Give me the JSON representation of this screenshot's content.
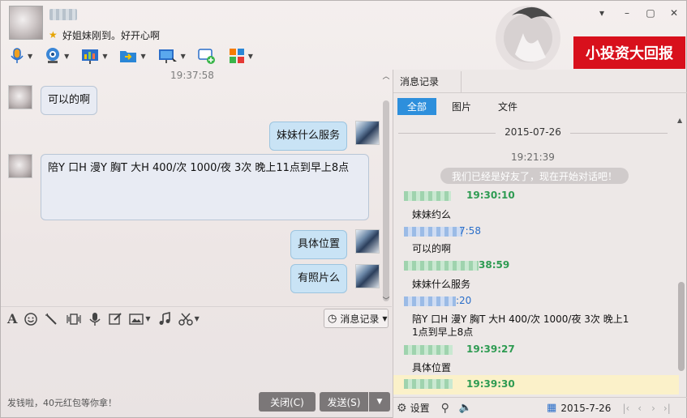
{
  "contact": {
    "signature": "好姐妹刚到。好开心啊"
  },
  "ad_banner": "小投资大回报",
  "chat": {
    "time": "19:37:58",
    "messages": [
      {
        "dir": "in",
        "text": "可以的啊"
      },
      {
        "dir": "out",
        "text": "妹妹什么服务"
      },
      {
        "dir": "in",
        "text": "陪Y 口H  漫Y    胸T  大H  400/次  1000/夜  3次 晚上11点到早上8点"
      },
      {
        "dir": "out",
        "text": "具体位置"
      },
      {
        "dir": "out",
        "text": "有照片么"
      }
    ]
  },
  "input_toolbar": {
    "history_button": "消息记录"
  },
  "footer": {
    "ad_text": "发钱啦，40元红包等你拿！",
    "close_button": "关闭(C)",
    "send_button": "发送(S)"
  },
  "history": {
    "tab_title": "消息记录",
    "filters": [
      "全部",
      "图片",
      "文件"
    ],
    "active_filter": "全部",
    "date": "2015-07-26",
    "system_time": "19:21:39",
    "system_msg": "我们已经是好友了，现在开始对话吧！",
    "entries": [
      {
        "who": "them",
        "time": "19:30:10",
        "text": "妹妹约么"
      },
      {
        "who": "me",
        "time": "7:58",
        "text": "可以的啊"
      },
      {
        "who": "them",
        "time": "38:59",
        "text": "妹妹什么服务"
      },
      {
        "who": "me",
        "time": ":20",
        "text_lines": [
          "陪Y 口H  漫Y    胸T  大H  400/次  1000/夜  3次 晚上1",
          "1点到早上8点"
        ]
      },
      {
        "who": "them",
        "time": "19:39:27",
        "text": "具体位置"
      },
      {
        "who": "them",
        "time": "19:39:30",
        "text": ""
      }
    ],
    "settings_label": "设置",
    "bottom_date": "2015-7-26"
  },
  "colors": {
    "accent": "#2d8fdc",
    "them_time": "#2e9b52",
    "me_time": "#2a6ec9",
    "ad_red": "#d8101c",
    "highlight_row": "#fbf1c9"
  }
}
